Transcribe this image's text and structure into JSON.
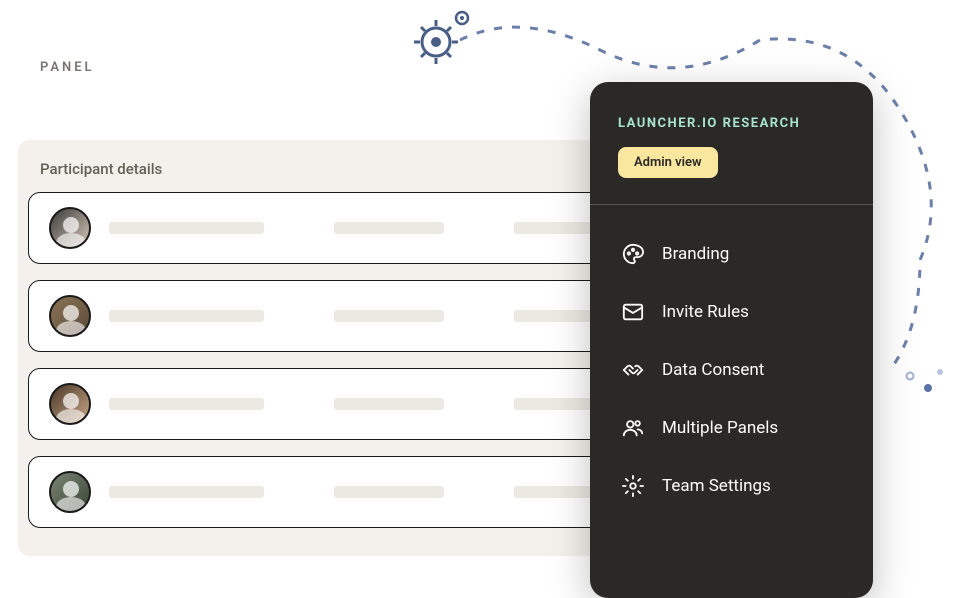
{
  "panel_label": "PANEL",
  "details": {
    "header": "Participant details"
  },
  "menu": {
    "title": "LAUNCHER.IO RESEARCH",
    "badge": "Admin view",
    "items": [
      {
        "label": "Branding"
      },
      {
        "label": "Invite Rules"
      },
      {
        "label": "Data Consent"
      },
      {
        "label": "Multiple Panels"
      },
      {
        "label": "Team Settings"
      }
    ]
  }
}
